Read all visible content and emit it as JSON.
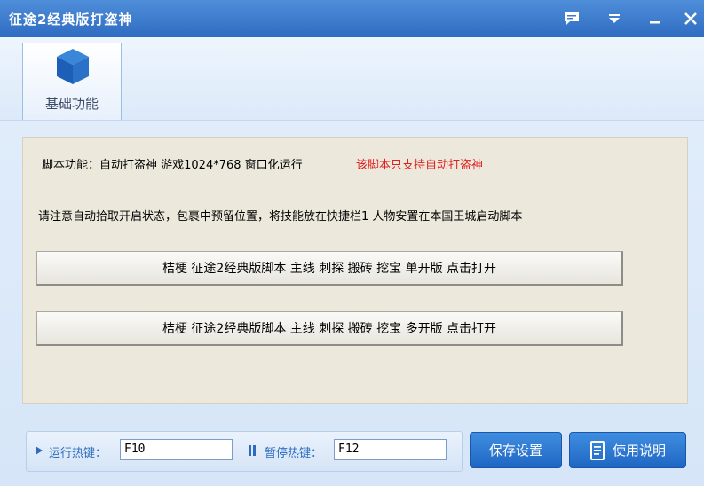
{
  "window": {
    "title": "征途2经典版打盗神"
  },
  "titlebar_icons": [
    "feedback-icon",
    "menu-dropdown-icon",
    "minimize-icon",
    "close-icon"
  ],
  "toolbar": {
    "tab_label": "基础功能",
    "tab_icon": "cube-icon"
  },
  "content": {
    "line1": "脚本功能：自动打盗神 游戏1024*768 窗口化运行",
    "warning": "该脚本只支持自动打盗神",
    "line2": "请注意自动拾取开启状态，包裹中预留位置，将技能放在快捷栏1 人物安置在本国王城启动脚本",
    "button1": "桔梗    征途2经典版脚本 主线 刺探 搬砖 挖宝  单开版 点击打开",
    "button2": "桔梗    征途2经典版脚本 主线 刺探 搬砖 挖宝  多开版  点击打开"
  },
  "hotkeys": {
    "run_label": "运行热键：",
    "run_value": "F10",
    "pause_label": "暂停热键：",
    "pause_value": "F12"
  },
  "actions": {
    "save_label": "保存设置",
    "help_label": "使用说明"
  },
  "colors": {
    "accent": "#2f6cc2",
    "warning": "#e02020"
  }
}
